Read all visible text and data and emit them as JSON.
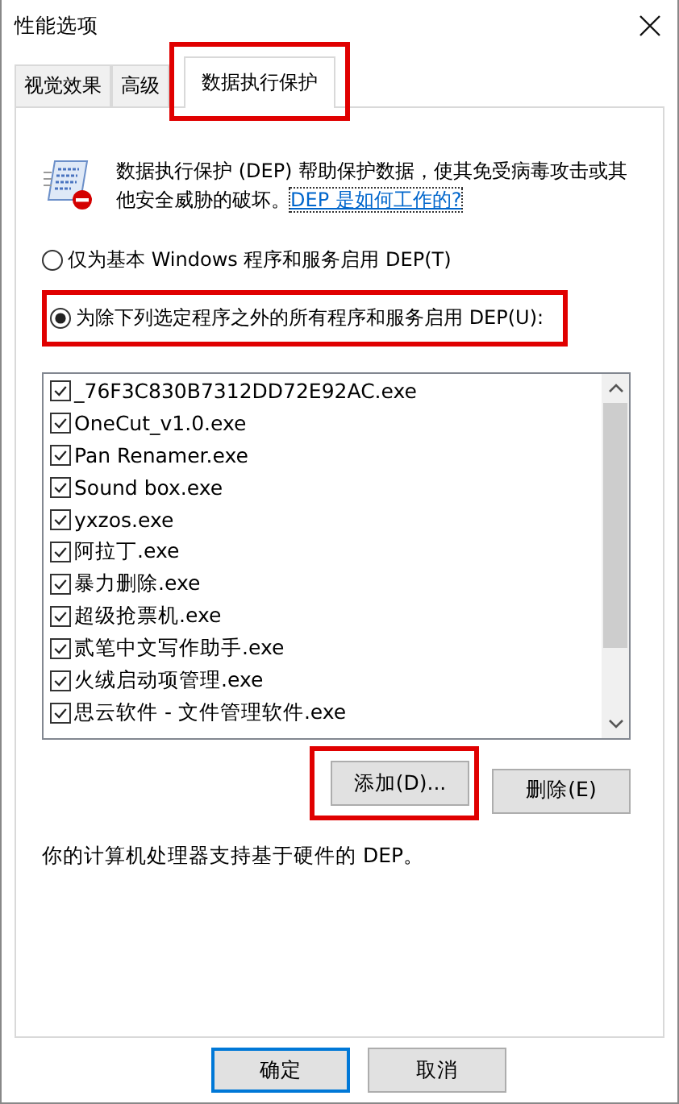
{
  "window": {
    "title": "性能选项"
  },
  "tabs": [
    {
      "label": "视觉效果",
      "selected": false,
      "highlighted": false
    },
    {
      "label": "高级",
      "selected": false,
      "highlighted": false
    },
    {
      "label": "数据执行保护",
      "selected": true,
      "highlighted": true
    }
  ],
  "description": {
    "text": "数据执行保护 (DEP) 帮助保护数据，使其免受病毒攻击或其他安全威胁的破坏。",
    "link": "DEP 是如何工作的?"
  },
  "options": [
    {
      "label": "仅为基本 Windows 程序和服务启用 DEP(T)",
      "selected": false,
      "highlighted": false
    },
    {
      "label": "为除下列选定程序之外的所有程序和服务启用 DEP(U):",
      "selected": true,
      "highlighted": true
    }
  ],
  "programs": [
    {
      "name": "_76F3C830B7312DD72E92AC.exe",
      "checked": true
    },
    {
      "name": "OneCut_v1.0.exe",
      "checked": true
    },
    {
      "name": "Pan Renamer.exe",
      "checked": true
    },
    {
      "name": "Sound box.exe",
      "checked": true
    },
    {
      "name": "yxzos.exe",
      "checked": true
    },
    {
      "name": "阿拉丁.exe",
      "checked": true
    },
    {
      "name": "暴力删除.exe",
      "checked": true
    },
    {
      "name": "超级抢票机.exe",
      "checked": true
    },
    {
      "name": "贰笔中文写作助手.exe",
      "checked": true
    },
    {
      "name": "火绒启动项管理.exe",
      "checked": true
    },
    {
      "name": "思云软件 - 文件管理软件.exe",
      "checked": true
    }
  ],
  "list_buttons": [
    {
      "label": "添加(D)...",
      "highlighted": true
    },
    {
      "label": "删除(E)",
      "highlighted": false
    }
  ],
  "hardware_note": "你的计算机处理器支持基于硬件的 DEP。",
  "buttons": [
    {
      "label": "确定",
      "default": true
    },
    {
      "label": "取消",
      "default": false
    }
  ]
}
